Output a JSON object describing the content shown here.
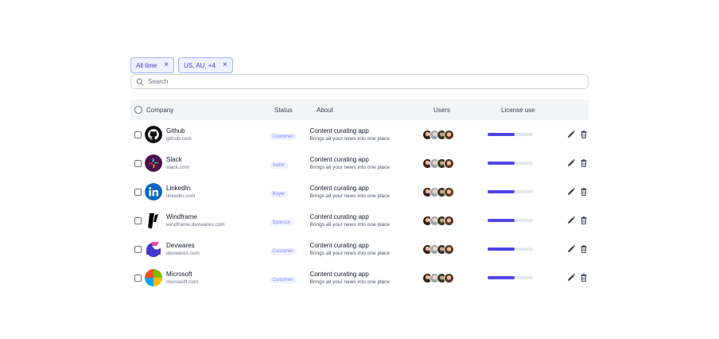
{
  "filters": [
    {
      "label": "All time"
    },
    {
      "label": "US, AU, +4"
    }
  ],
  "search": {
    "placeholder": "Search",
    "value": ""
  },
  "table": {
    "headers": {
      "company": "Company",
      "status": "Status",
      "about": "About",
      "users": "Users",
      "license": "License use"
    },
    "rows": [
      {
        "company": "Github",
        "domain": "github.com",
        "status": "Customer",
        "about_title": "Content curating app",
        "about_desc": "Brings all your news into one place",
        "license_fraction": 0.6,
        "logo_icon": "github-logo-icon"
      },
      {
        "company": "Slack",
        "domain": "slack.com",
        "status": "Seller",
        "about_title": "Content curating app",
        "about_desc": "Brings all your news into one place",
        "license_fraction": 0.6,
        "logo_icon": "slack-logo-icon"
      },
      {
        "company": "LinkedIn",
        "domain": "linkedin.com",
        "status": "Buyer",
        "about_title": "Content curating app",
        "about_desc": "Brings all your news into one place",
        "license_fraction": 0.6,
        "logo_icon": "linkedin-logo-icon"
      },
      {
        "company": "Windframe",
        "domain": "windframe.devwares.com",
        "status": "Sponsor",
        "about_title": "Content curating app",
        "about_desc": "Brings all your news into one place",
        "license_fraction": 0.6,
        "logo_icon": "windframe-logo-icon"
      },
      {
        "company": "Devwares",
        "domain": "devwares.com",
        "status": "Customer",
        "about_title": "Content curating app",
        "about_desc": "Brings all your news into one place",
        "license_fraction": 0.6,
        "logo_icon": "devwares-logo-icon"
      },
      {
        "company": "Microsoft",
        "domain": "microsoft.com",
        "status": "Customer",
        "about_title": "Content curating app",
        "about_desc": "Brings all your news into one place",
        "license_fraction": 0.6,
        "logo_icon": "microsoft-logo-icon"
      }
    ]
  },
  "colors": {
    "accent": "#4f46e5",
    "chip_bg": "#eef2ff",
    "badge_text": "#818cf8"
  }
}
